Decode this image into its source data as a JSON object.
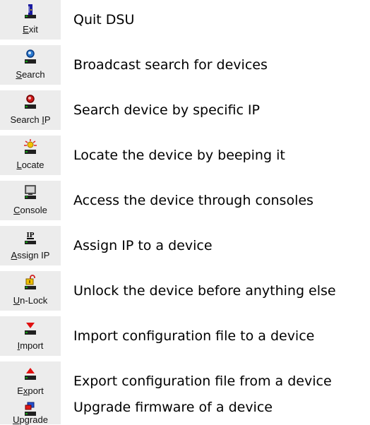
{
  "items": [
    {
      "key": "exit",
      "label_pre": "",
      "label_ul": "E",
      "label_post": "xit",
      "description": "Quit DSU",
      "icon": "exit-door-icon"
    },
    {
      "key": "search",
      "label_pre": "",
      "label_ul": "S",
      "label_post": "earch",
      "description": "Broadcast search for devices",
      "icon": "magnifier-user-icon"
    },
    {
      "key": "searchip",
      "label_pre": "Search ",
      "label_ul": "I",
      "label_post": "P",
      "description": "Search device by specific IP",
      "icon": "red-user-search-icon"
    },
    {
      "key": "locate",
      "label_pre": "",
      "label_ul": "L",
      "label_post": "ocate",
      "description": "Locate the device by beeping it",
      "icon": "beep-light-icon"
    },
    {
      "key": "console",
      "label_pre": "",
      "label_ul": "C",
      "label_post": "onsole",
      "description": "Access the device through consoles",
      "icon": "monitor-icon"
    },
    {
      "key": "assignip",
      "label_pre": "",
      "label_ul": "A",
      "label_post": "ssign IP",
      "description": "Assign IP to a device",
      "icon": "ip-icon"
    },
    {
      "key": "unlock",
      "label_pre": "",
      "label_ul": "U",
      "label_post": "n-Lock",
      "description": "Unlock the device before anything else",
      "icon": "padlock-icon"
    },
    {
      "key": "import",
      "label_pre": "",
      "label_ul": "I",
      "label_post": "mport",
      "description": "Import configuration file to a device",
      "icon": "arrow-down-icon"
    },
    {
      "key": "export",
      "label_pre": "E",
      "label_ul": "x",
      "label_post": "port",
      "description": "Export configuration file from a device",
      "icon": "arrow-up-icon"
    },
    {
      "key": "upgrade",
      "label_pre": "",
      "label_ul": "U",
      "label_post": "pgrade",
      "description": "Upgrade firmware of a device",
      "icon": "firmware-chip-icon"
    }
  ]
}
